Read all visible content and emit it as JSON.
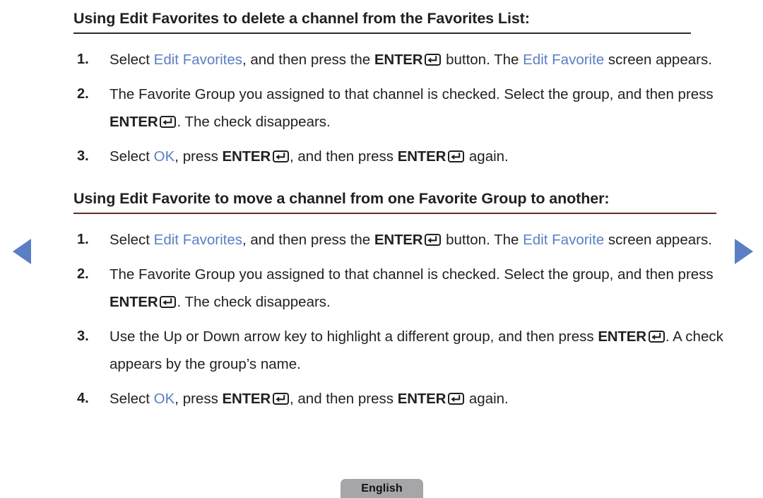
{
  "page": {
    "language_button_label": "English",
    "accent_blue": "#5b7ec4",
    "text_color": "#231f20",
    "rule_color": "#2e2b2c",
    "rule_accent_color": "#5a3028",
    "button_bg": "#a6a6a9"
  },
  "nav": {
    "prev_icon": "triangle-left-icon",
    "next_icon": "triangle-right-icon"
  },
  "sections": [
    {
      "heading": "Using Edit Favorites to delete a channel from the Favorites List:",
      "steps": [
        {
          "number": "1.",
          "runs": [
            {
              "type": "text",
              "value": "Select "
            },
            {
              "type": "blue",
              "value": "Edit Favorites"
            },
            {
              "type": "text",
              "value": ", and then press the "
            },
            {
              "type": "bold",
              "value": "ENTER"
            },
            {
              "type": "enter-key",
              "value": "enter-key-icon"
            },
            {
              "type": "text",
              "value": " button. The "
            },
            {
              "type": "blue",
              "value": "Edit Favorite"
            },
            {
              "type": "text",
              "value": " screen appears."
            }
          ]
        },
        {
          "number": "2.",
          "runs": [
            {
              "type": "text",
              "value": "The Favorite Group you assigned to that channel is checked. Select the group, and then press "
            },
            {
              "type": "bold",
              "value": "ENTER"
            },
            {
              "type": "enter-key",
              "value": "enter-key-icon"
            },
            {
              "type": "text",
              "value": ". The check disappears."
            }
          ]
        },
        {
          "number": "3.",
          "runs": [
            {
              "type": "text",
              "value": "Select "
            },
            {
              "type": "blue",
              "value": "OK"
            },
            {
              "type": "text",
              "value": ", press "
            },
            {
              "type": "bold",
              "value": "ENTER"
            },
            {
              "type": "enter-key",
              "value": "enter-key-icon"
            },
            {
              "type": "text",
              "value": ", and then press "
            },
            {
              "type": "bold",
              "value": "ENTER"
            },
            {
              "type": "enter-key",
              "value": "enter-key-icon"
            },
            {
              "type": "text",
              "value": " again."
            }
          ]
        }
      ]
    },
    {
      "heading": "Using Edit Favorite to move a channel from one Favorite Group to another:",
      "steps": [
        {
          "number": "1.",
          "runs": [
            {
              "type": "text",
              "value": "Select "
            },
            {
              "type": "blue",
              "value": "Edit Favorites"
            },
            {
              "type": "text",
              "value": ", and then press the "
            },
            {
              "type": "bold",
              "value": "ENTER"
            },
            {
              "type": "enter-key",
              "value": "enter-key-icon"
            },
            {
              "type": "text",
              "value": " button. The "
            },
            {
              "type": "blue",
              "value": "Edit Favorite"
            },
            {
              "type": "text",
              "value": " screen appears."
            }
          ]
        },
        {
          "number": "2.",
          "runs": [
            {
              "type": "text",
              "value": "The Favorite Group you assigned to that channel is checked. Select the group, and then press "
            },
            {
              "type": "bold",
              "value": "ENTER"
            },
            {
              "type": "enter-key",
              "value": "enter-key-icon"
            },
            {
              "type": "text",
              "value": ". The check disappears."
            }
          ]
        },
        {
          "number": "3.",
          "runs": [
            {
              "type": "text",
              "value": "Use the Up or Down arrow key to highlight a different group, and then press "
            },
            {
              "type": "bold",
              "value": "ENTER"
            },
            {
              "type": "enter-key",
              "value": "enter-key-icon"
            },
            {
              "type": "text",
              "value": ". A check appears by the group’s name."
            }
          ]
        },
        {
          "number": "4.",
          "runs": [
            {
              "type": "text",
              "value": "Select "
            },
            {
              "type": "blue",
              "value": "OK"
            },
            {
              "type": "text",
              "value": ", press "
            },
            {
              "type": "bold",
              "value": "ENTER"
            },
            {
              "type": "enter-key",
              "value": "enter-key-icon"
            },
            {
              "type": "text",
              "value": ", and then press "
            },
            {
              "type": "bold",
              "value": "ENTER"
            },
            {
              "type": "enter-key",
              "value": "enter-key-icon"
            },
            {
              "type": "text",
              "value": " again."
            }
          ]
        }
      ]
    }
  ]
}
